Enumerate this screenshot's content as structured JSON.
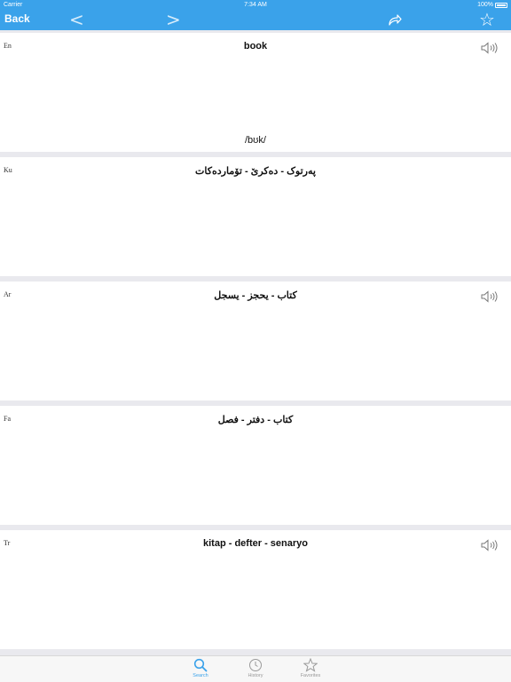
{
  "status": {
    "carrier": "Carrier",
    "time": "7:34 AM",
    "battery": "100%"
  },
  "nav": {
    "back_label": "Back",
    "prev_glyph": "<",
    "next_glyph": ">",
    "favorite_glyph": "☆"
  },
  "entries": [
    {
      "lang": "En",
      "word": "book",
      "pronunciation": "/bʊk/",
      "has_audio": true
    },
    {
      "lang": "Ku",
      "word": "پەرتوک - دەکرێ - تۆماردەکات",
      "has_audio": false
    },
    {
      "lang": "Ar",
      "word": "كتاب - يحجز - يسجل",
      "has_audio": true
    },
    {
      "lang": "Fa",
      "word": "کتاب - دفتر - فصل",
      "has_audio": false
    },
    {
      "lang": "Tr",
      "word": "kitap - defter - senaryo",
      "has_audio": true
    }
  ],
  "tabs": [
    {
      "label": "Search",
      "icon": "search-icon",
      "active": true
    },
    {
      "label": "History",
      "icon": "clock-icon",
      "active": false
    },
    {
      "label": "Favorites",
      "icon": "star-icon",
      "active": false
    }
  ],
  "colors": {
    "accent": "#3aa2ea",
    "background": "#e9e9ee"
  }
}
